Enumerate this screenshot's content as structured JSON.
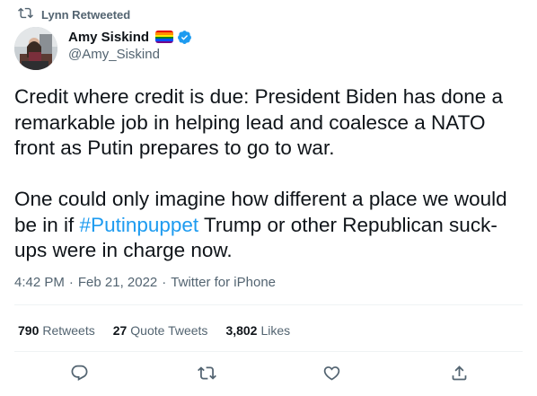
{
  "retweet_context": {
    "label": "Lynn Retweeted",
    "icon": "retweet-icon"
  },
  "author": {
    "display_name": "Amy Siskind",
    "handle": "@Amy_Siskind",
    "badges": [
      "rainbow-flag-icon",
      "verified-badge-icon"
    ]
  },
  "tweet": {
    "paragraph1": "Credit where credit is due: President Biden has done a remarkable job in helping lead and coalesce a NATO front as Putin prepares to go to war.",
    "paragraph2_before": "One could only imagine how different a place we would be in if ",
    "hashtag": "#Putinpuppet",
    "paragraph2_after": " Trump or other Republican suck-ups were in charge now."
  },
  "meta": {
    "time": "4:42 PM",
    "separator": "·",
    "date": "Feb 21, 2022",
    "source": "Twitter for iPhone"
  },
  "stats": {
    "retweets_count": "790",
    "retweets_label": "Retweets",
    "quotes_count": "27",
    "quotes_label": "Quote Tweets",
    "likes_count": "3,802",
    "likes_label": "Likes"
  },
  "actions": [
    "reply-icon",
    "retweet-icon",
    "like-icon",
    "share-icon"
  ],
  "colors": {
    "link": "#1d9bf0",
    "secondary_text": "#536471",
    "divider": "#eff3f4",
    "primary_text": "#0f1419"
  }
}
